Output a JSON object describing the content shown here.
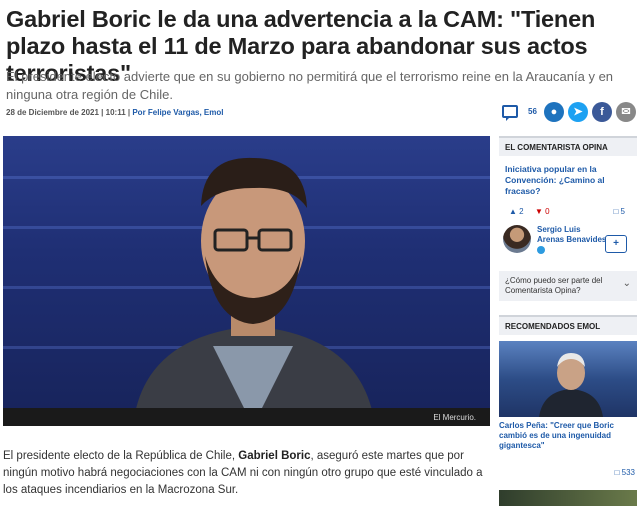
{
  "article": {
    "headline": "Gabriel Boric le da una advertencia a la CAM: \"Tienen plazo hasta el 11 de Marzo para abandonar sus actos terroristas\"",
    "subhead": "El presidente electo advierte que en su gobierno no permitirá que el terrorismo reine en la Araucanía y en ninguna otra región de Chile.",
    "date": "28 de Diciembre de 2021 | 10:11 |",
    "author": "Por Felipe Vargas, Emol",
    "photo_credit": "El Mercurio.",
    "body_pre": "El presidente electo de la República de Chile, ",
    "body_bold": "Gabriel Boric",
    "body_post": ", aseguró este martes que por ningún motivo habrá negociaciones con la CAM ni con ningún otro grupo que esté vinculado a los ataques incendiarios en la Macrozona Sur."
  },
  "social": {
    "comment_count": "56",
    "icons": [
      "comment-icon",
      "user-icon",
      "twitter-icon",
      "facebook-icon",
      "mail-icon"
    ]
  },
  "sidebar": {
    "opina_header": "EL COMENTARISTA OPINA",
    "question": "Iniciativa popular en la Convención: ¿Camino al fracaso?",
    "votes_up": "2",
    "votes_down": "0",
    "comments": "5",
    "columnist_name": "Sergio Luis Arenas Benavides",
    "how_text": "¿Cómo puedo ser parte del Comentarista Opina?",
    "rec_header": "RECOMENDADOS EMOL",
    "rec_title": "Carlos Peña: \"Creer que Boric cambió es de una ingenuidad gigantesca\"",
    "rec_count": "533"
  }
}
